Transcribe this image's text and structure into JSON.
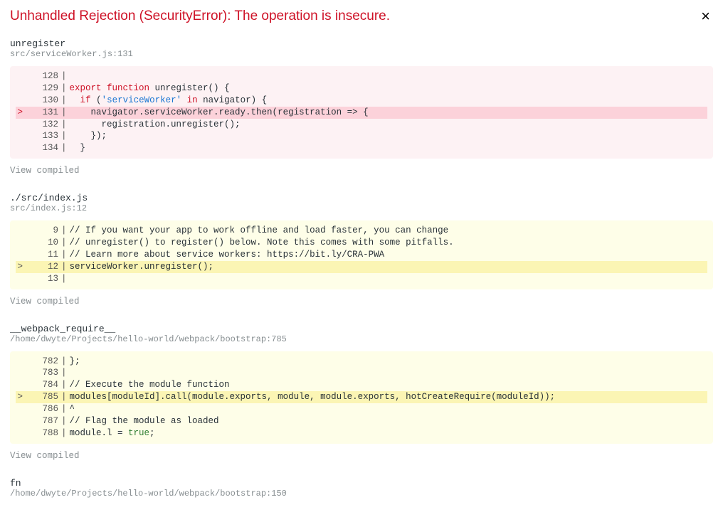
{
  "title": "Unhandled Rejection (SecurityError): The operation is insecure.",
  "close_label": "×",
  "view_compiled": "View compiled",
  "frames": [
    {
      "fn": "unregister",
      "loc": "src/serviceWorker.js:131",
      "style": "pink",
      "lines": {
        "l128": {
          "num": "128",
          "t": ""
        },
        "l129": {
          "num": "129",
          "kw1": "export ",
          "kw2": "function",
          "t": " unregister() {"
        },
        "l130": {
          "num": "130",
          "pre": "  ",
          "kw": "if",
          "t1": " (",
          "str": "'serviceWorker'",
          "t2": " ",
          "kw2": "in",
          "t3": " navigator) {"
        },
        "l131": {
          "num": "131",
          "t": "    navigator.serviceWorker.ready.then(registration => {"
        },
        "l132": {
          "num": "132",
          "t": "      registration.unregister();"
        },
        "l133": {
          "num": "133",
          "t": "    });"
        },
        "l134": {
          "num": "134",
          "t": "  }"
        }
      }
    },
    {
      "fn": "./src/index.js",
      "loc": "src/index.js:12",
      "style": "yellow",
      "lines": {
        "l9": {
          "num": "  9",
          "t": "// If you want your app to work offline and load faster, you can change"
        },
        "l10": {
          "num": " 10",
          "t": "// unregister() to register() below. Note this comes with some pitfalls."
        },
        "l11": {
          "num": " 11",
          "t": "// Learn more about service workers: https://bit.ly/CRA-PWA"
        },
        "l12": {
          "num": " 12",
          "t": "serviceWorker.unregister();"
        },
        "l13": {
          "num": " 13",
          "t": ""
        }
      }
    },
    {
      "fn": "__webpack_require__",
      "loc": "/home/dwyte/Projects/hello-world/webpack/bootstrap:785",
      "style": "yellow",
      "lines": {
        "l782": {
          "num": "782",
          "t": "};"
        },
        "l783": {
          "num": "783",
          "t": ""
        },
        "l784": {
          "num": "784",
          "t": "// Execute the module function"
        },
        "l785": {
          "num": "785",
          "t": "modules[moduleId].call(module.exports, module, module.exports, hotCreateRequire(moduleId));"
        },
        "l786": {
          "num": "786",
          "t": "^"
        },
        "l787": {
          "num": "787",
          "t": "// Flag the module as loaded"
        },
        "l788": {
          "num": "788",
          "t1": "module.l = ",
          "kw": "true",
          "t2": ";"
        }
      }
    },
    {
      "fn": "fn",
      "loc": "/home/dwyte/Projects/hello-world/webpack/bootstrap:150"
    }
  ]
}
